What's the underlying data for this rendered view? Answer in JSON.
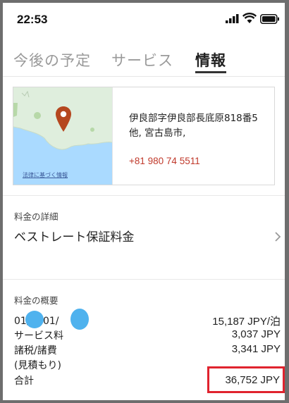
{
  "status_bar": {
    "time": "22:53"
  },
  "tabs": [
    {
      "label": "今後の予定",
      "active": false
    },
    {
      "label": "サービス",
      "active": false
    },
    {
      "label": "情報",
      "active": true
    }
  ],
  "location": {
    "map_link": "法律に基づく情報",
    "address": "伊良部字伊良部長底原818番5他, 宮古島市,",
    "phone": "+81 980 74 5511"
  },
  "rate_details": {
    "label": "料金の詳細",
    "name": "ベストレート保証料金"
  },
  "rate_summary": {
    "label": "料金の概要",
    "rows": [
      {
        "label": "01/  〜01/",
        "value": "15,187 JPY/泊"
      },
      {
        "label": "サービス料",
        "value": "3,037 JPY"
      },
      {
        "label": "諸税/諸費",
        "value": "3,341 JPY"
      },
      {
        "label": "(見積もり)",
        "value": ""
      },
      {
        "label": "合計",
        "value": "36,752 JPY"
      }
    ]
  },
  "colors": {
    "accent": "#c0392b",
    "highlight_box": "#e0232e",
    "map_water": "#aadaff",
    "map_land": "#dfeedd"
  }
}
